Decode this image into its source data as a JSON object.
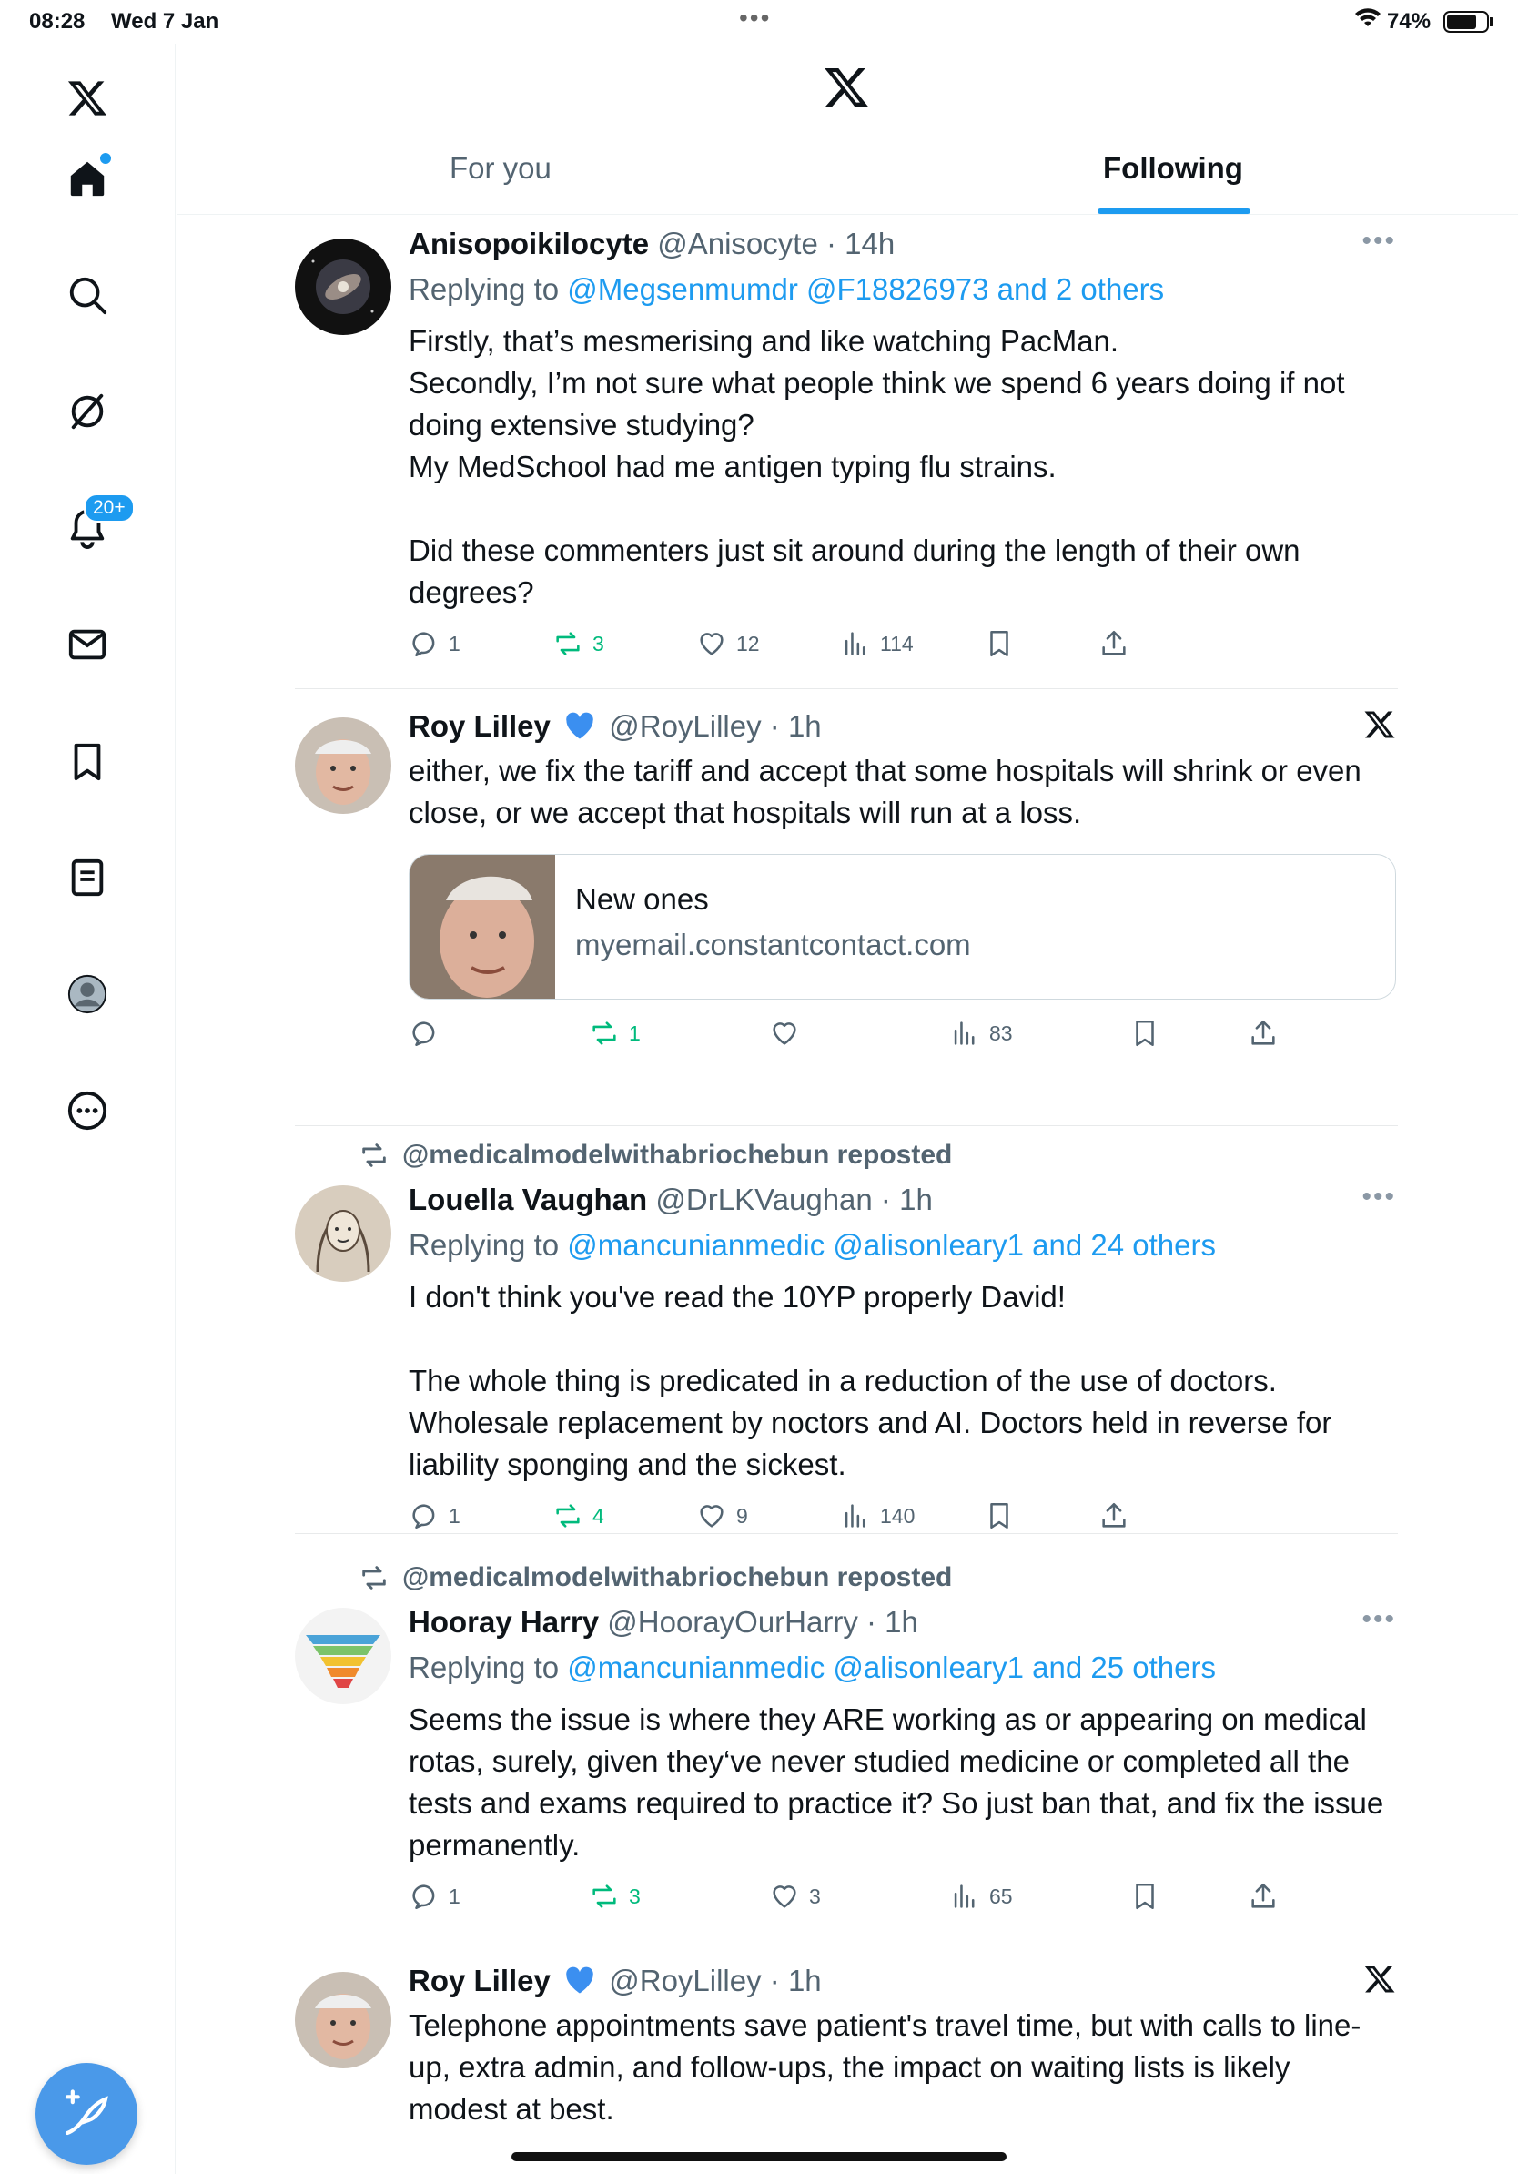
{
  "status_bar": {
    "time": "08:28",
    "date": "Wed 7 Jan",
    "battery": "74%"
  },
  "sidebar": {
    "items": [
      {
        "name": "x-logo",
        "icon": "x-logo-icon"
      },
      {
        "name": "home",
        "icon": "home-icon"
      },
      {
        "name": "search",
        "icon": "search-icon"
      },
      {
        "name": "grok",
        "icon": "grok-icon"
      },
      {
        "name": "notifications",
        "icon": "bell-icon",
        "badge": "20+"
      },
      {
        "name": "messages",
        "icon": "mail-icon"
      },
      {
        "name": "bookmarks",
        "icon": "bookmark-icon"
      },
      {
        "name": "lists",
        "icon": "list-icon"
      },
      {
        "name": "profile",
        "icon": "avatar-icon"
      },
      {
        "name": "more",
        "icon": "more-circle-icon"
      }
    ],
    "compose_icon": "compose-icon"
  },
  "header": {
    "tabs": [
      {
        "label": "For you",
        "active": false
      },
      {
        "label": "Following",
        "active": true
      }
    ]
  },
  "colors": {
    "accent": "#1d9bf0",
    "repost_green": "#00ba7c",
    "secondary_text": "#536471"
  },
  "feed": [
    {
      "name": "Anisopoikilocyte",
      "handle": "@Anisocyte",
      "time": "14h",
      "replying_prefix": "Replying to",
      "replying_links": "@Megsenmumdr @F18826973 and 2 others",
      "text": "Firstly, that’s mesmerising and like watching PacMan.\nSecondly, I’m not sure what people think we spend 6 years doing if not doing extensive studying?\nMy MedSchool had me antigen typing flu strains.\n\nDid these commenters just sit around during the length of their own degrees?",
      "replies": "1",
      "reposts": "3",
      "likes": "12",
      "views": "114"
    },
    {
      "name": "Roy Lilley",
      "handle": "@RoyLilley",
      "time": "1h",
      "text": "either, we fix the tariff and accept that some hospitals will shrink or even close, or we accept that hospitals will run at a loss.",
      "card_title": "New ones",
      "card_domain": "myemail.constantcontact.com",
      "reposts": "1",
      "views": "83"
    },
    {
      "reposted_by": "@medicalmodelwithabriochebun reposted",
      "name": "Louella Vaughan",
      "handle": "@DrLKVaughan",
      "time": "1h",
      "replying_prefix": "Replying to",
      "replying_links": "@mancunianmedic @alisonleary1 and 24 others",
      "text": "I don't think you've read the 10YP properly David!\n\nThe whole thing is predicated in a reduction of the use of doctors. Wholesale replacement by noctors and AI. Doctors held in reverse for liability sponging and the sickest.",
      "replies": "1",
      "reposts": "4",
      "likes": "9",
      "views": "140"
    },
    {
      "reposted_by": "@medicalmodelwithabriochebun reposted",
      "name": "Hooray Harry",
      "handle": "@HoorayOurHarry",
      "time": "1h",
      "replying_prefix": "Replying to",
      "replying_links": "@mancunianmedic @alisonleary1 and 25 others",
      "text": "Seems the issue is where they ARE working as or appearing on medical rotas, surely, given they‘ve never studied medicine or completed all the tests and exams required to practice it? So just ban that, and fix the issue permanently.",
      "replies": "1",
      "reposts": "3",
      "likes": "3",
      "views": "65"
    },
    {
      "name": "Roy Lilley",
      "handle": "@RoyLilley",
      "time": "1h",
      "text": "Telephone appointments save patient's travel time, but with calls to line-up, extra admin, and follow-ups, the impact on waiting lists is likely modest at best."
    }
  ]
}
